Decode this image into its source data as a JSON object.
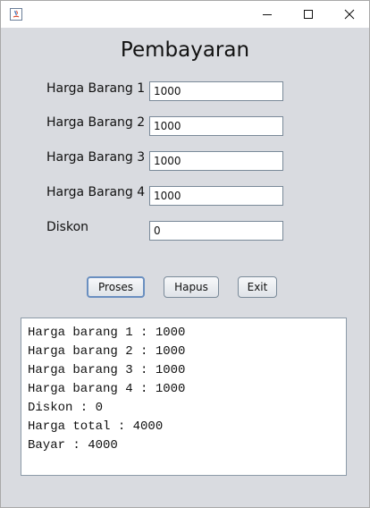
{
  "window": {
    "title_bar_text": "",
    "controls": {
      "minimize_label": "–",
      "maximize_label": "☐",
      "close_label": "✕"
    }
  },
  "form": {
    "title": "Pembayaran",
    "fields": [
      {
        "label": "Harga Barang 1",
        "value": "1000"
      },
      {
        "label": "Harga Barang 2",
        "value": "1000"
      },
      {
        "label": "Harga Barang 3",
        "value": "1000"
      },
      {
        "label": "Harga Barang 4",
        "value": "1000"
      },
      {
        "label": "Diskon",
        "value": "0"
      }
    ]
  },
  "buttons": {
    "proses": "Proses",
    "hapus": "Hapus",
    "exit": "Exit"
  },
  "output": {
    "lines": [
      "Harga barang 1 : 1000",
      "Harga barang 2 : 1000",
      "Harga barang 3 : 1000",
      "Harga barang 4 : 1000",
      "Diskon : 0",
      "Harga total : 4000",
      "Bayar : 4000"
    ]
  }
}
